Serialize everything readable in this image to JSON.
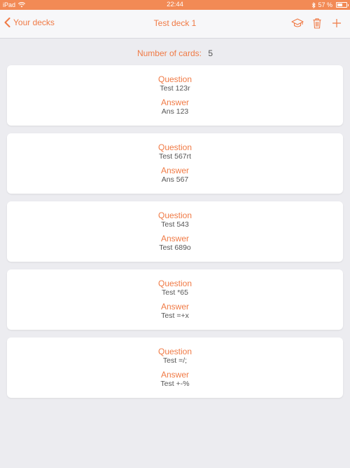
{
  "status_bar": {
    "device": "iPad",
    "time": "22:44",
    "battery": "57 %",
    "battery_level": 0.57
  },
  "nav": {
    "back_label": "Your decks",
    "title": "Test deck 1",
    "icons": [
      "graduation-cap-icon",
      "trash-icon",
      "plus-icon"
    ]
  },
  "summary": {
    "count_label": "Number of cards:",
    "count_value": "5"
  },
  "cards": [
    {
      "question_label": "Question",
      "question": "Test 123r",
      "answer_label": "Answer",
      "answer": "Ans 123"
    },
    {
      "question_label": "Question",
      "question": "Test 567rt",
      "answer_label": "Answer",
      "answer": "Ans 567"
    },
    {
      "question_label": "Question",
      "question": "Test 543",
      "answer_label": "Answer",
      "answer": "Test 689o"
    },
    {
      "question_label": "Question",
      "question": "Test *65",
      "answer_label": "Answer",
      "answer": "Test =+x"
    },
    {
      "question_label": "Question",
      "question": "Test =/;",
      "answer_label": "Answer",
      "answer": "Test +-%"
    }
  ],
  "colors": {
    "accent": "#f07a45",
    "status_bar": "#f28a55",
    "background": "#ececf0"
  }
}
